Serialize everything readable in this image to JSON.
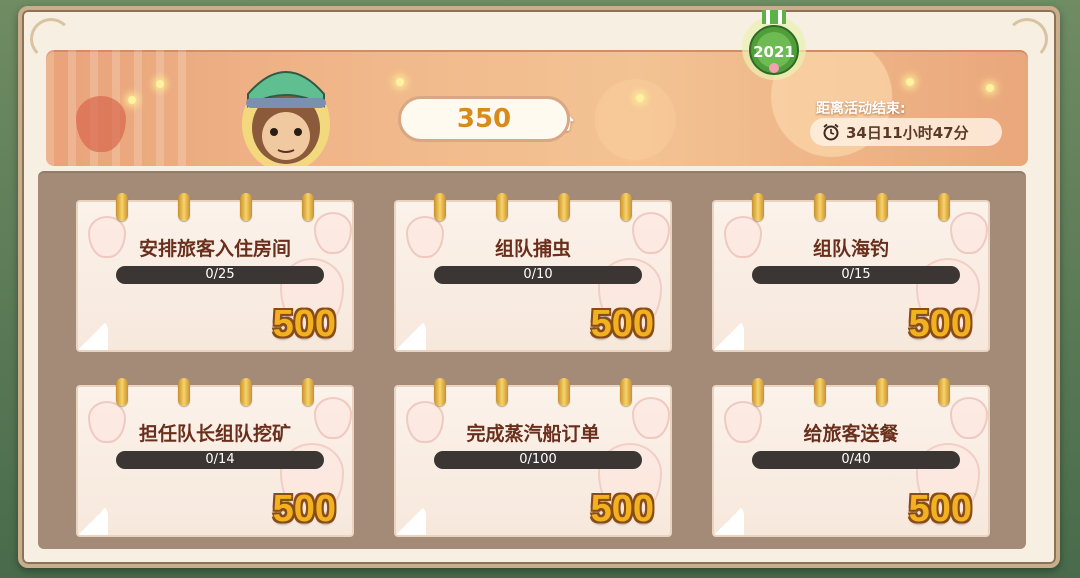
{
  "header": {
    "score_label": "当前积分",
    "score_value": "350",
    "medal_year": "2021",
    "timer_label": "距离活动结束:",
    "timer_value": "34日11小时47分"
  },
  "tasks": [
    {
      "title": "安排旅客入住房间",
      "progress": "0/25",
      "points": "500"
    },
    {
      "title": "组队捕虫",
      "progress": "0/10",
      "points": "500"
    },
    {
      "title": "组队海钓",
      "progress": "0/15",
      "points": "500"
    },
    {
      "title": "担任队长组队挖矿",
      "progress": "0/14",
      "points": "500"
    },
    {
      "title": "完成蒸汽船订单",
      "progress": "0/100",
      "points": "500"
    },
    {
      "title": "给旅客送餐",
      "progress": "0/40",
      "points": "500"
    }
  ],
  "icons": {
    "avatar": "monkey-character-avatar",
    "medal": "medal-icon",
    "clock": "alarm-clock-icon"
  },
  "colors": {
    "banner": "#f1b98b",
    "board": "#a38b77",
    "points": "#f2b21f",
    "title_text": "#6a2f1c"
  }
}
